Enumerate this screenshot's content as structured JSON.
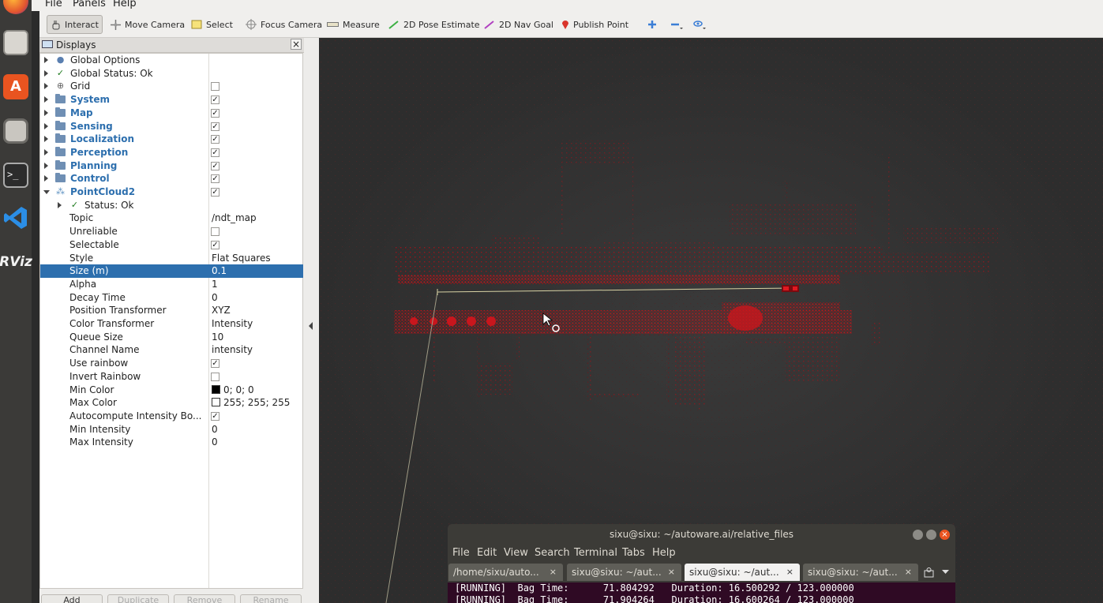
{
  "menubar": {
    "items": [
      "File",
      "Panels",
      "Help"
    ]
  },
  "toolbar": {
    "tools": [
      {
        "label": "Interact",
        "icon": "hand-icon"
      },
      {
        "label": "Move Camera",
        "icon": "move-camera-icon"
      },
      {
        "label": "Select",
        "icon": "select-icon"
      },
      {
        "label": "Focus Camera",
        "icon": "focus-camera-icon"
      },
      {
        "label": "Measure",
        "icon": "ruler-icon"
      },
      {
        "label": "2D Pose Estimate",
        "icon": "pose-arrow-icon"
      },
      {
        "label": "2D Nav Goal",
        "icon": "nav-goal-arrow-icon"
      },
      {
        "label": "Publish Point",
        "icon": "map-pin-icon"
      }
    ],
    "active": "Interact"
  },
  "displays": {
    "title": "Displays",
    "close": "×",
    "rows": [
      {
        "name": "Global Options",
        "value": ""
      },
      {
        "name": "Global Status: Ok",
        "value": ""
      },
      {
        "name": "Grid",
        "value": ""
      },
      {
        "name": "System",
        "value": ""
      },
      {
        "name": "Map",
        "value": ""
      },
      {
        "name": "Sensing",
        "value": ""
      },
      {
        "name": "Localization",
        "value": ""
      },
      {
        "name": "Perception",
        "value": ""
      },
      {
        "name": "Planning",
        "value": ""
      },
      {
        "name": "Control",
        "value": ""
      },
      {
        "name": "PointCloud2",
        "value": ""
      },
      {
        "name": "Status: Ok",
        "value": ""
      },
      {
        "name": "Topic",
        "value": "/ndt_map"
      },
      {
        "name": "Unreliable",
        "value": ""
      },
      {
        "name": "Selectable",
        "value": ""
      },
      {
        "name": "Style",
        "value": "Flat Squares"
      },
      {
        "name": "Size (m)",
        "value": "0.1"
      },
      {
        "name": "Alpha",
        "value": "1"
      },
      {
        "name": "Decay Time",
        "value": "0"
      },
      {
        "name": "Position Transformer",
        "value": "XYZ"
      },
      {
        "name": "Color Transformer",
        "value": "Intensity"
      },
      {
        "name": "Queue Size",
        "value": "10"
      },
      {
        "name": "Channel Name",
        "value": "intensity"
      },
      {
        "name": "Use rainbow",
        "value": ""
      },
      {
        "name": "Invert Rainbow",
        "value": ""
      },
      {
        "name": "Min Color",
        "value": "0; 0; 0"
      },
      {
        "name": "Max Color",
        "value": "255; 255; 255"
      },
      {
        "name": "Autocompute Intensity Bo...",
        "value": ""
      },
      {
        "name": "Min Intensity",
        "value": "0"
      },
      {
        "name": "Max Intensity",
        "value": "0"
      }
    ],
    "checkbox_mark": "✓",
    "buttons": [
      "Add",
      "Duplicate",
      "Remove",
      "Rename"
    ]
  },
  "terminal": {
    "title": "sixu@sixu: ~/autoware.ai/relative_files",
    "menu": [
      "File",
      "Edit",
      "View",
      "Search",
      "Terminal",
      "Tabs",
      "Help"
    ],
    "tabs": [
      "/home/sixu/auto...",
      "sixu@sixu: ~/aut...",
      "sixu@sixu: ~/aut...",
      "sixu@sixu: ~/aut..."
    ],
    "active_tab": 2,
    "tab_close": "×",
    "lines": [
      "[RUNNING]  Bag Time:      71.804292   Duration: 16.500292 / 123.000000",
      "[RUNNING]  Bag Time:      71.904264   Duration: 16.600264 / 123.000000"
    ]
  },
  "launcher": {
    "icons": [
      "firefox-icon",
      "files-icon",
      "software-center-icon",
      "camera-icon",
      "terminal-icon",
      "vscode-icon",
      "rviz-icon"
    ],
    "rviz_label": "RViz"
  },
  "colors": {
    "selection": "#2d6fae",
    "group_text": "#2d6fae",
    "points": "#c0141a",
    "terminal_bg": "#2f0a24"
  }
}
